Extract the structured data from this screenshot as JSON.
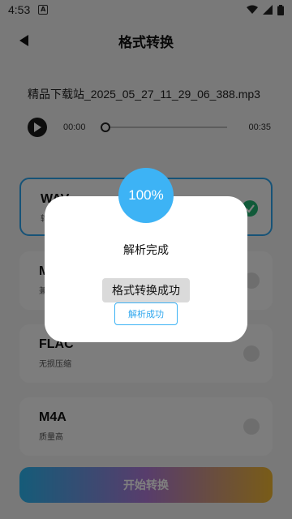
{
  "status_bar": {
    "time": "4:53",
    "notif_letter": "A"
  },
  "header": {
    "title": "格式转换"
  },
  "file": {
    "name": "精品下载站_2025_05_27_11_29_06_388.mp3"
  },
  "player": {
    "current_time": "00:00",
    "total_time": "00:35",
    "progress": 0
  },
  "formats": [
    {
      "name": "WAV",
      "desc": "转",
      "selected": true
    },
    {
      "name": "M",
      "desc": "兼",
      "selected": false
    },
    {
      "name": "FLAC",
      "desc": "无损压缩",
      "selected": false
    },
    {
      "name": "M4A",
      "desc": "质量高",
      "selected": false
    }
  ],
  "start_button": {
    "label": "开始转换"
  },
  "dialog": {
    "percent": "100%",
    "status": "解析完成",
    "toast": "格式转换成功",
    "button": "解析成功"
  },
  "colors": {
    "accent": "#3db3f5",
    "check": "#22b573",
    "overlay": "rgba(0,0,0,0.5)"
  }
}
